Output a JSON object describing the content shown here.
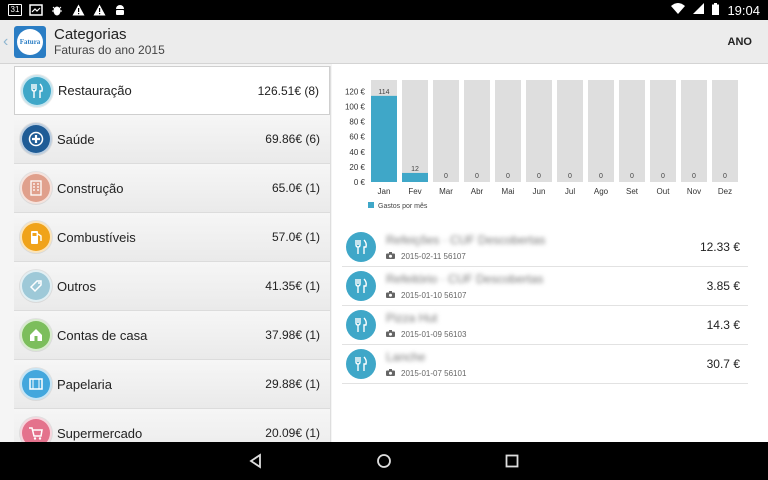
{
  "status_bar": {
    "time": "19:04",
    "calendar_day": "31",
    "icons": [
      "calendar-icon",
      "message-icon",
      "bug-icon",
      "warning-icon",
      "warning-icon",
      "android-icon"
    ]
  },
  "header": {
    "title": "Categorias",
    "subtitle": "Faturas do ano 2015",
    "logo_text": "Fatura",
    "action_label": "ANO"
  },
  "categories": [
    {
      "name": "Restauração",
      "amount": "126.51€ (8)",
      "icon": "fork-knife-icon",
      "color": "#3fa7c8",
      "selected": true
    },
    {
      "name": "Saúde",
      "amount": "69.86€ (6)",
      "icon": "medical-cross-icon",
      "color": "#1f5c96",
      "selected": false
    },
    {
      "name": "Construção",
      "amount": "65.0€ (1)",
      "icon": "building-icon",
      "color": "#e0a08c",
      "selected": false
    },
    {
      "name": "Combustíveis",
      "amount": "57.0€ (1)",
      "icon": "fuel-pump-icon",
      "color": "#f0a31a",
      "selected": false
    },
    {
      "name": "Outros",
      "amount": "41.35€ (1)",
      "icon": "tag-icon",
      "color": "#9ec9d8",
      "selected": false
    },
    {
      "name": "Contas de casa",
      "amount": "37.98€ (1)",
      "icon": "house-icon",
      "color": "#7cbe5c",
      "selected": false
    },
    {
      "name": "Papelaria",
      "amount": "29.88€ (1)",
      "icon": "book-icon",
      "color": "#43a7dd",
      "selected": false
    },
    {
      "name": "Supermercado",
      "amount": "20.09€ (1)",
      "icon": "cart-icon",
      "color": "#e4728c",
      "selected": false
    }
  ],
  "chart_data": {
    "type": "bar",
    "categories": [
      "Jan",
      "Fev",
      "Mar",
      "Abr",
      "Mai",
      "Jun",
      "Jul",
      "Ago",
      "Set",
      "Out",
      "Nov",
      "Dez"
    ],
    "series": [
      {
        "name": "Gastos por mês",
        "values": [
          114,
          12,
          0,
          0,
          0,
          0,
          0,
          0,
          0,
          0,
          0,
          0
        ],
        "color": "#3fa7c8"
      }
    ],
    "data_labels": [
      "114",
      "12",
      "0",
      "0",
      "0",
      "0",
      "0",
      "0",
      "0",
      "0",
      "0",
      "0"
    ],
    "y_ticks": [
      "0 €",
      "20 €",
      "40 €",
      "60 €",
      "80 €",
      "100 €",
      "120 €"
    ],
    "ylim": [
      0,
      135
    ],
    "legend_position": "bottom-left",
    "background_bar_color": "#dedede",
    "grid": false
  },
  "expenses": [
    {
      "name": "Refeições · CUF Descobertas",
      "meta": "2015-02-11 56107",
      "amount": "12.33 €",
      "icon": "fork-knife-icon"
    },
    {
      "name": "Refeitório · CUF Descobertas",
      "meta": "2015-01-10 56107",
      "amount": "3.85 €",
      "icon": "fork-knife-icon"
    },
    {
      "name": "Pizza Hut",
      "meta": "2015-01-09 56103",
      "amount": "14.3 €",
      "icon": "fork-knife-icon"
    },
    {
      "name": "Lanche",
      "meta": "2015-01-07 56101",
      "amount": "30.7 €",
      "icon": "fork-knife-icon"
    }
  ],
  "nav_bar": {
    "buttons": [
      "back-triangle-icon",
      "home-circle-icon",
      "recents-square-icon"
    ]
  }
}
